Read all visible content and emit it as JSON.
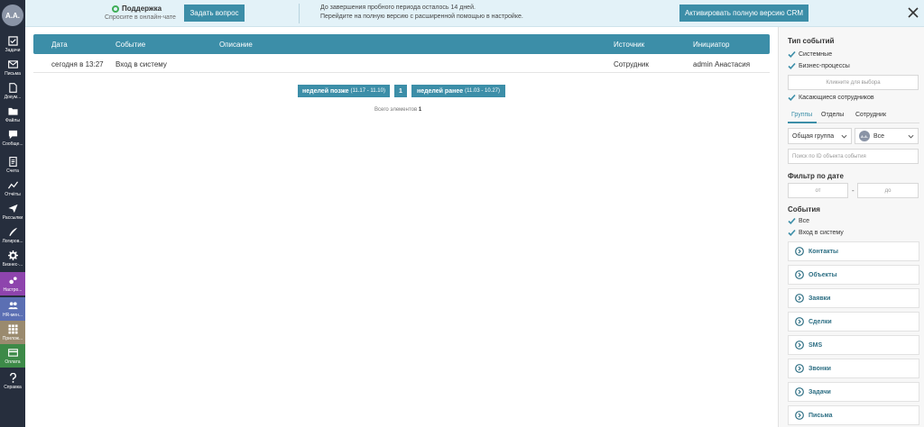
{
  "sidebar": {
    "avatar": "A.A.",
    "items": [
      {
        "label": "Задачи",
        "icon": "tasks-icon"
      },
      {
        "label": "Письма",
        "icon": "mail-icon"
      },
      {
        "label": "Докум...",
        "icon": "document-icon"
      },
      {
        "label": "Файлы",
        "icon": "folder-icon"
      },
      {
        "label": "Сообще...",
        "icon": "chat-icon"
      },
      {
        "label": "Счета",
        "icon": "invoice-icon"
      },
      {
        "label": "Отчёты",
        "icon": "chart-icon"
      },
      {
        "label": "Рассылки",
        "icon": "send-icon"
      },
      {
        "label": "Логиров...",
        "icon": "pen-icon"
      },
      {
        "label": "Бизнес-...",
        "icon": "gear-icon"
      },
      {
        "label": "Настро...",
        "icon": "settings-icon"
      },
      {
        "label": "HR-мен...",
        "icon": "people-icon"
      },
      {
        "label": "Прилож...",
        "icon": "apps-icon"
      },
      {
        "label": "Оплата",
        "icon": "payment-icon"
      },
      {
        "label": "Справка",
        "icon": "help-icon"
      }
    ]
  },
  "banner": {
    "support_title": "Поддержка",
    "support_sub": "Спросите в онлайн-чате",
    "ask_button": "Задать вопрос",
    "trial_line1": "До завершения пробного периода осталось 14 дней.",
    "trial_line2": "Перейдите на полную версию с расширенной помощью в настройке.",
    "activate_button": "Активировать полную версию CRM"
  },
  "table": {
    "columns": [
      "Дата",
      "Событие",
      "Описание",
      "Источник",
      "Инициатор"
    ],
    "rows": [
      {
        "date": "сегодня в 13:27",
        "event": "Вход в систему",
        "description": "",
        "source": "Сотрудник",
        "initiator": "admin Анастасия"
      }
    ]
  },
  "pager": {
    "later_label": "неделей позже",
    "later_range": "(11.17 - 11.10)",
    "current_page": "1",
    "earlier_label": "неделей ранее",
    "earlier_range": "(11.03 - 10.27)",
    "total_label": "Всего элементов",
    "total_value": "1"
  },
  "filters": {
    "event_type_title": "Тип событий",
    "type_system": "Системные",
    "type_business": "Бизнес-процессы",
    "select_placeholder": "Кликните для выбора",
    "type_employees": "Касающиеся сотрудников",
    "tabs": [
      "Группы",
      "Отделы",
      "Сотрудник"
    ],
    "group_select": "Общая группа",
    "user_avatar": "A.A.",
    "user_select": "Все",
    "id_search_placeholder": "Поиск по ID объекта события",
    "date_title": "Фильтр по дате",
    "date_from": "от",
    "date_separator": "-",
    "date_to": "до",
    "events_title": "События",
    "events_all": "Все",
    "events_login": "Вход в систему",
    "groups": [
      "Контакты",
      "Объекты",
      "Заявки",
      "Сделки",
      "SMS",
      "Звонки",
      "Задачи",
      "Письма"
    ]
  },
  "colors": {
    "accent": "#3c8ea8",
    "sidebar": "#262e3d",
    "banner": "#e3f2f8",
    "nav_settings": "#8e44ad",
    "nav_hr": "#5b6fb3",
    "nav_apps": "#9a8a6e",
    "nav_payment": "#3d8a48"
  }
}
